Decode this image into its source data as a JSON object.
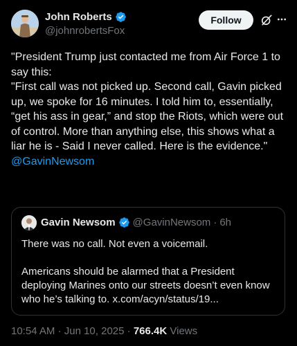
{
  "author": {
    "name": "John Roberts",
    "handle": "@johnrobertsFox",
    "verified": true
  },
  "follow_label": "Follow",
  "icons": {
    "grok": "grok-icon",
    "more": "more-icon",
    "verified": "verified-badge-icon"
  },
  "tweet": {
    "text": "\"President Trump just contacted me from Air Force 1 to say this:\n\"First call was not picked up. Second call, Gavin picked up, we spoke for 16 minutes. I told him to, essentially, “get his ass in gear,” and stop the Riots, which were out of control. More than anything else, this shows what a liar he is - Said I never called. Here is the evidence.\"",
    "mention": "@GavinNewsom"
  },
  "quote": {
    "name": "Gavin Newsom",
    "handle": "@GavinNewsom",
    "separator": "·",
    "time": "6h",
    "paragraph1": "There was no call. Not even a voicemail.",
    "paragraph2": "Americans should be alarmed that a President deploying Marines onto our streets doesn’t even know who he’s talking to. x.com/acyn/status/19..."
  },
  "meta": {
    "time": "10:54 AM",
    "date": "Jun 10, 2025",
    "separator": "·",
    "views": "766.4K",
    "views_label": "Views"
  },
  "colors": {
    "background": "#000000",
    "text": "#e7e9ea",
    "secondary": "#71767b",
    "link": "#1d9bf0",
    "border": "#2f3336",
    "verified": "#1d9bf0"
  }
}
